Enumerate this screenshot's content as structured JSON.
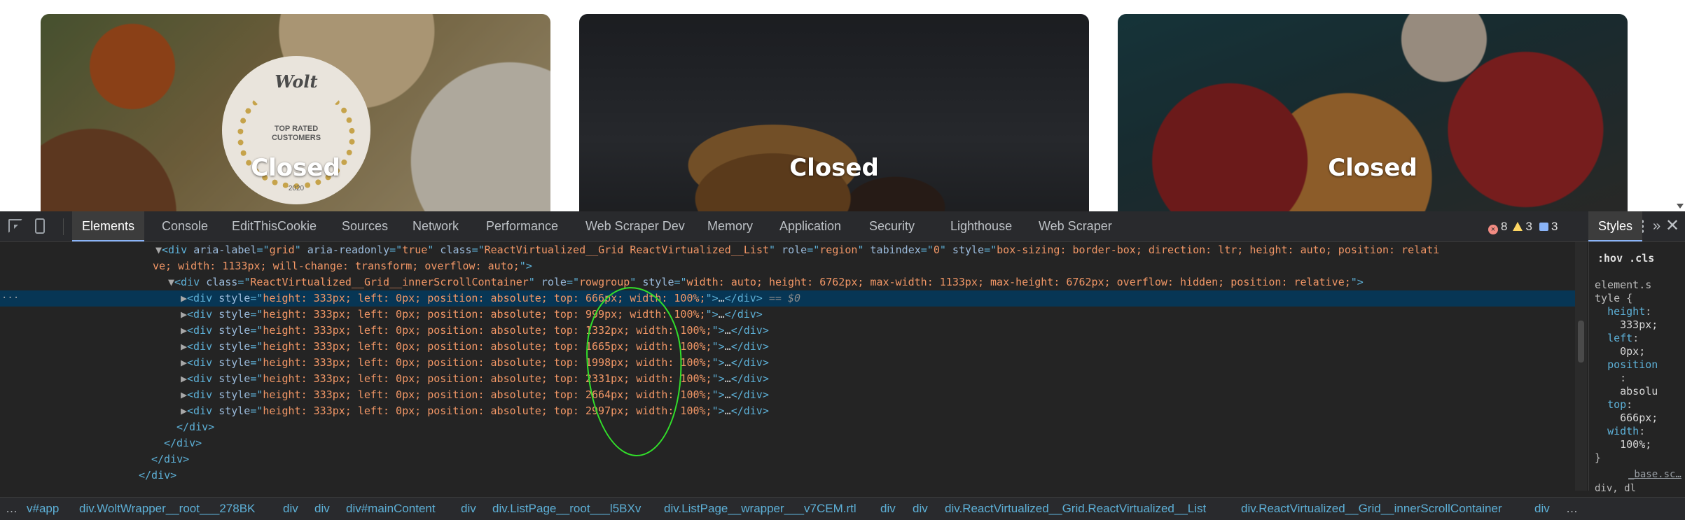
{
  "cards": [
    {
      "status": "Closed",
      "badge": {
        "brand": "Wolt",
        "line1": "TOP RATED",
        "line2": "CUSTOMERS",
        "year": "2020"
      }
    },
    {
      "status": "Closed"
    },
    {
      "status": "Closed"
    }
  ],
  "devtools": {
    "tabs": [
      "Elements",
      "Console",
      "EditThisCookie",
      "Sources",
      "Network",
      "Performance",
      "Web Scraper Dev",
      "Memory",
      "Application",
      "Security",
      "Lighthouse",
      "Web Scraper"
    ],
    "active_tab": "Elements",
    "errors": "8",
    "warnings": "3",
    "messages": "3",
    "dom": {
      "grid_line1": {
        "aria_label": "grid",
        "aria_readonly": "true",
        "class": "ReactVirtualized__Grid ReactVirtualized__List",
        "role": "region",
        "tabindex": "0",
        "style_part1": "box-sizing: border-box; direction: ltr; height: auto; position: relati",
        "style_part2": "ve; width: 1133px; will-change: transform; overflow: auto;"
      },
      "inner": {
        "class": "ReactVirtualized__Grid__innerScrollContainer",
        "role": "rowgroup",
        "style": "width: auto; height: 6762px; max-width: 1133px; max-height: 6762px; overflow: hidden; position: relative;"
      },
      "rows": [
        {
          "style": "height: 333px; left: 0px; position: absolute; top: 666px; width: 100%;",
          "selected": true,
          "suffix": "== $0"
        },
        {
          "style": "height: 333px; left: 0px; position: absolute; top: 999px; width: 100%;"
        },
        {
          "style": "height: 333px; left: 0px; position: absolute; top: 1332px; width: 100%;"
        },
        {
          "style": "height: 333px; left: 0px; position: absolute; top: 1665px; width: 100%;"
        },
        {
          "style": "height: 333px; left: 0px; position: absolute; top: 1998px; width: 100%;"
        },
        {
          "style": "height: 333px; left: 0px; position: absolute; top: 2331px; width: 100%;"
        },
        {
          "style": "height: 333px; left: 0px; position: absolute; top: 2664px; width: 100%;"
        },
        {
          "style": "height: 333px; left: 0px; position: absolute; top: 2997px; width: 100%;"
        }
      ],
      "closing_tag": "</div>"
    },
    "styles_panel": {
      "tab": "Styles",
      "filter": ":hov .cls",
      "selector_a": "element.s",
      "selector_b": "tyle {",
      "props": [
        {
          "name": "height",
          "value": "333px;"
        },
        {
          "name": "left",
          "value": "0px;"
        },
        {
          "name": "position",
          "value": "absolu"
        },
        {
          "name": "top",
          "value": "666px;"
        },
        {
          "name": "width",
          "value": "100%;"
        }
      ],
      "close": "}",
      "base_link": "_base.sc…",
      "base_sel": "div, dl"
    },
    "breadcrumbs": [
      "v#app",
      "div.WoltWrapper__root___278BK",
      "div",
      "div",
      "div#mainContent",
      "div",
      "div.ListPage__root___l5BXv",
      "div.ListPage__wrapper___v7CEM.rtl",
      "div",
      "div",
      "div.ReactVirtualized__Grid.ReactVirtualized__List",
      "div.ReactVirtualized__Grid__innerScrollContainer",
      "div",
      "…"
    ]
  }
}
